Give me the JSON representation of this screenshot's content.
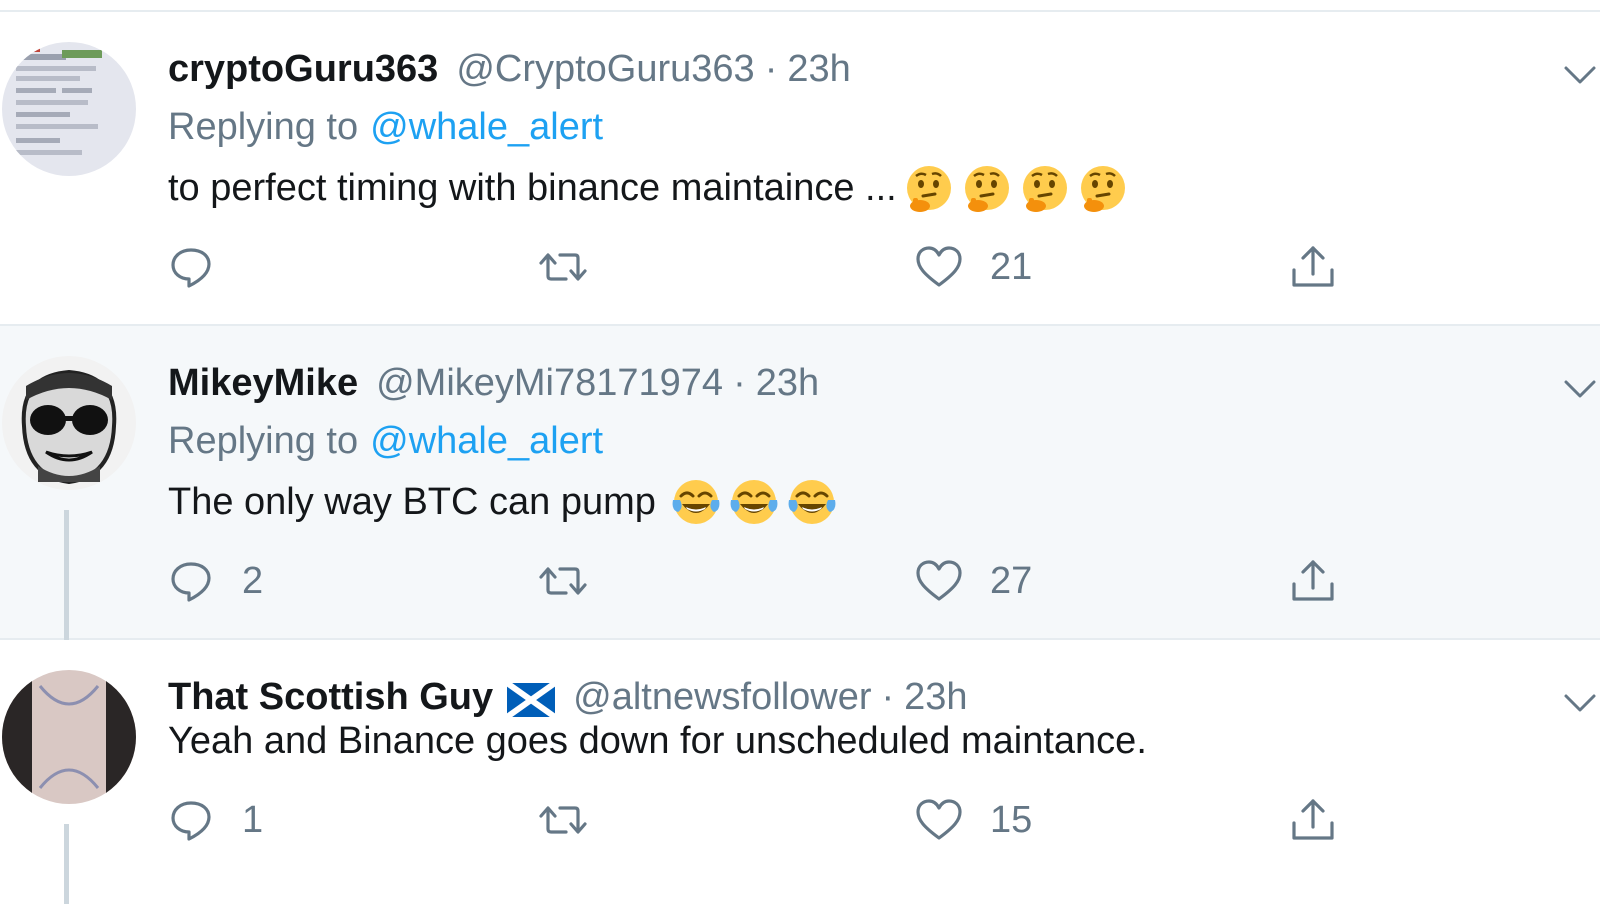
{
  "tweets": [
    {
      "display_name": "cryptoGuru363",
      "handle": "@CryptoGuru363",
      "separator": "·",
      "time": "23h",
      "replying_prefix": "Replying to",
      "replying_to": "@whale_alert",
      "text": "to perfect timing with binance maintaince ...",
      "emoji": [
        "thinking-face",
        "thinking-face",
        "thinking-face",
        "thinking-face"
      ],
      "actions": {
        "replies": "",
        "retweets": "",
        "likes": "21"
      }
    },
    {
      "display_name": "MikeyMike",
      "handle": "@MikeyMi78171974",
      "separator": "·",
      "time": "23h",
      "replying_prefix": "Replying to",
      "replying_to": "@whale_alert",
      "text": "The only way BTC can pump",
      "emoji": [
        "tears-of-joy-face",
        "tears-of-joy-face",
        "tears-of-joy-face"
      ],
      "actions": {
        "replies": "2",
        "retweets": "",
        "likes": "27"
      }
    },
    {
      "display_name": "That Scottish Guy",
      "flag_icon": "scotland-flag",
      "handle": "@altnewsfollower",
      "separator": "·",
      "time": "23h",
      "text": "Yeah and Binance goes down for unscheduled maintance.",
      "actions": {
        "replies": "1",
        "retweets": "",
        "likes": "15"
      }
    }
  ],
  "colors": {
    "text": "#14171a",
    "secondary": "#657786",
    "link": "#1da1f2",
    "highlight_bg": "#f5f8fa",
    "divider": "#e6ecf0"
  }
}
